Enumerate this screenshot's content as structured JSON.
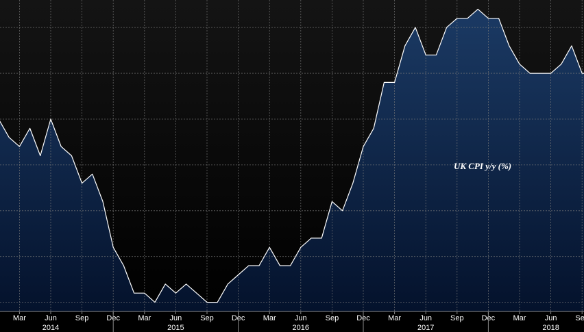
{
  "chart_data": {
    "type": "area",
    "series": [
      {
        "name": "UK CPI y/y (%)",
        "color": "#ffffff",
        "fill_top": "#1b3a64",
        "fill_bottom": "#04122c",
        "x": [
          "2014-01",
          "2014-02",
          "2014-03",
          "2014-04",
          "2014-05",
          "2014-06",
          "2014-07",
          "2014-08",
          "2014-09",
          "2014-10",
          "2014-11",
          "2014-12",
          "2015-01",
          "2015-02",
          "2015-03",
          "2015-04",
          "2015-05",
          "2015-06",
          "2015-07",
          "2015-08",
          "2015-09",
          "2015-10",
          "2015-11",
          "2015-12",
          "2016-01",
          "2016-02",
          "2016-03",
          "2016-04",
          "2016-05",
          "2016-06",
          "2016-07",
          "2016-08",
          "2016-09",
          "2016-10",
          "2016-11",
          "2016-12",
          "2017-01",
          "2017-02",
          "2017-03",
          "2017-04",
          "2017-05",
          "2017-06",
          "2017-07",
          "2017-08",
          "2017-09",
          "2017-10",
          "2017-11",
          "2017-12",
          "2018-01",
          "2018-02",
          "2018-03",
          "2018-04",
          "2018-05",
          "2018-06",
          "2018-07",
          "2018-08",
          "2018-09",
          "2018-10"
        ],
        "values": [
          1.9,
          1.7,
          1.6,
          1.8,
          1.5,
          1.9,
          1.6,
          1.5,
          1.2,
          1.3,
          1.0,
          0.5,
          0.3,
          0.0,
          0.0,
          -0.1,
          0.1,
          0.0,
          0.1,
          0.0,
          -0.1,
          -0.1,
          0.1,
          0.2,
          0.3,
          0.3,
          0.5,
          0.3,
          0.3,
          0.5,
          0.6,
          0.6,
          1.0,
          0.9,
          1.2,
          1.6,
          1.8,
          2.3,
          2.3,
          2.7,
          2.9,
          2.6,
          2.6,
          2.9,
          3.0,
          3.0,
          3.1,
          3.0,
          3.0,
          2.7,
          2.5,
          2.4,
          2.4,
          2.4,
          2.5,
          2.7,
          2.4,
          2.4
        ]
      }
    ],
    "month_ticks": [
      {
        "date": "2014-03",
        "label": "Mar"
      },
      {
        "date": "2014-06",
        "label": "Jun"
      },
      {
        "date": "2014-09",
        "label": "Sep"
      },
      {
        "date": "2014-12",
        "label": "Dec"
      },
      {
        "date": "2015-03",
        "label": "Mar"
      },
      {
        "date": "2015-06",
        "label": "Jun"
      },
      {
        "date": "2015-09",
        "label": "Sep"
      },
      {
        "date": "2015-12",
        "label": "Dec"
      },
      {
        "date": "2016-03",
        "label": "Mar"
      },
      {
        "date": "2016-06",
        "label": "Jun"
      },
      {
        "date": "2016-09",
        "label": "Sep"
      },
      {
        "date": "2016-12",
        "label": "Dec"
      },
      {
        "date": "2017-03",
        "label": "Mar"
      },
      {
        "date": "2017-06",
        "label": "Jun"
      },
      {
        "date": "2017-09",
        "label": "Sep"
      },
      {
        "date": "2017-12",
        "label": "Dec"
      },
      {
        "date": "2018-03",
        "label": "Mar"
      },
      {
        "date": "2018-06",
        "label": "Jun"
      },
      {
        "date": "2018-09",
        "label": "Sep"
      }
    ],
    "year_labels": [
      {
        "date": "2014-06",
        "label": "2014"
      },
      {
        "date": "2015-06",
        "label": "2015"
      },
      {
        "date": "2016-06",
        "label": "2016"
      },
      {
        "date": "2017-06",
        "label": "2017"
      },
      {
        "date": "2018-06",
        "label": "2018"
      }
    ],
    "year_dividers": [
      "2014-12",
      "2015-12",
      "2016-12",
      "2017-12"
    ],
    "ylim": [
      -0.2,
      3.2
    ],
    "y_gridlines": [
      -0.1,
      0.4,
      0.9,
      1.4,
      1.9,
      2.4,
      2.9
    ],
    "grid": true,
    "background_top": "#141414",
    "background_bottom": "#000000"
  }
}
